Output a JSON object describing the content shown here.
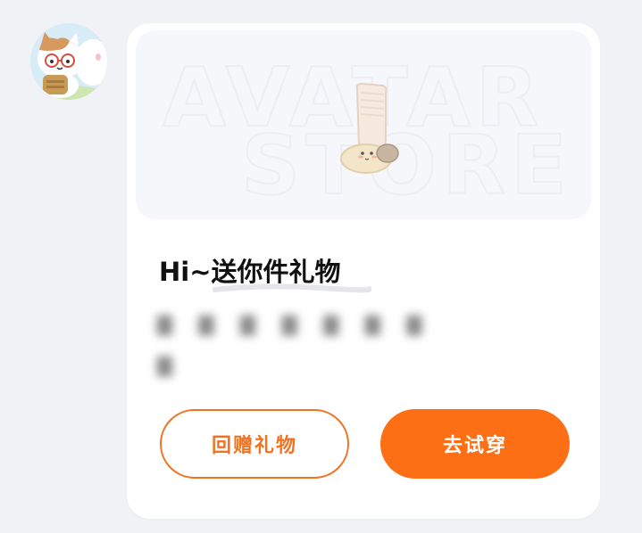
{
  "avatar": {
    "icon": "cat-with-backpack-avatar"
  },
  "banner": {
    "watermark_line1": "AVATAR",
    "watermark_line2": "STORE",
    "item_icon": "sock-gift-sticker"
  },
  "message": {
    "title": "Hi~送你件礼物"
  },
  "actions": {
    "return_gift_label": "回赠礼物",
    "try_on_label": "去试穿"
  },
  "colors": {
    "accent": "#fc6f14",
    "accent_outline": "#f07323",
    "background": "#f1f2f6",
    "card": "#ffffff"
  }
}
